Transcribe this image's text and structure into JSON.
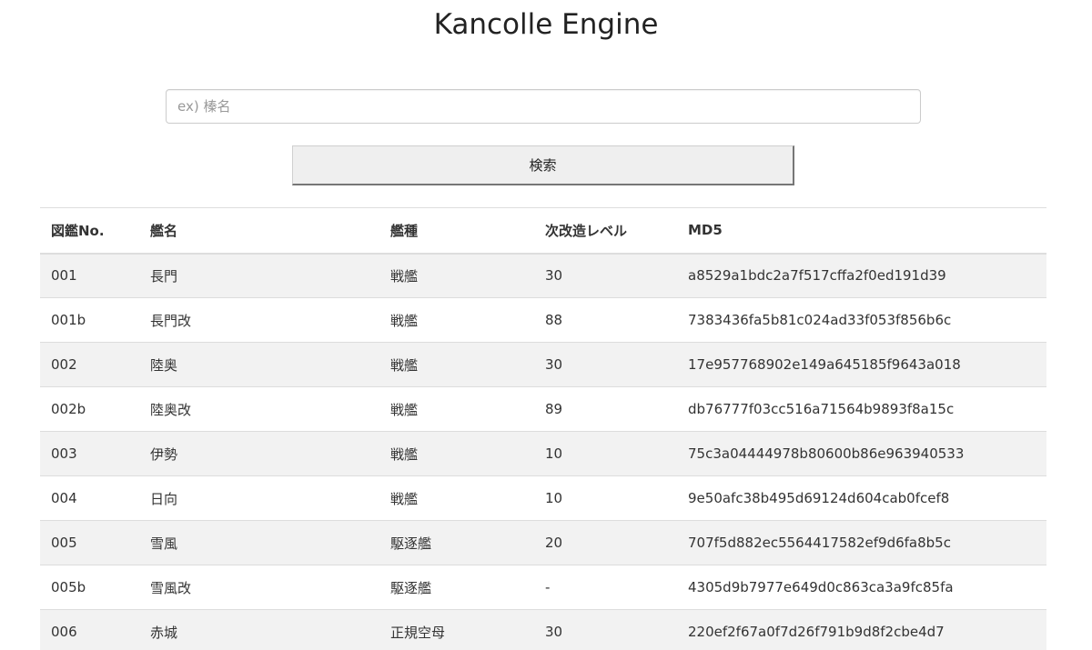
{
  "page": {
    "title": "Kancolle Engine"
  },
  "search": {
    "placeholder": "ex) 榛名",
    "value": "",
    "button_label": "検索"
  },
  "table": {
    "headers": [
      "図鑑No.",
      "艦名",
      "艦種",
      "次改造レベル",
      "MD5"
    ],
    "rows": [
      [
        "001",
        "長門",
        "戦艦",
        "30",
        "a8529a1bdc2a7f517cffa2f0ed191d39"
      ],
      [
        "001b",
        "長門改",
        "戦艦",
        "88",
        "7383436fa5b81c024ad33f053f856b6c"
      ],
      [
        "002",
        "陸奥",
        "戦艦",
        "30",
        "17e957768902e149a645185f9643a018"
      ],
      [
        "002b",
        "陸奥改",
        "戦艦",
        "89",
        "db76777f03cc516a71564b9893f8a15c"
      ],
      [
        "003",
        "伊勢",
        "戦艦",
        "10",
        "75c3a04444978b80600b86e963940533"
      ],
      [
        "004",
        "日向",
        "戦艦",
        "10",
        "9e50afc38b495d69124d604cab0fcef8"
      ],
      [
        "005",
        "雪風",
        "駆逐艦",
        "20",
        "707f5d882ec5564417582ef9d6fa8b5c"
      ],
      [
        "005b",
        "雪風改",
        "駆逐艦",
        "-",
        "4305d9b7977e649d0c863ca3a9fc85fa"
      ],
      [
        "006",
        "赤城",
        "正規空母",
        "30",
        "220ef2f67a0f7d26f791b9d8f2cbe4d7"
      ]
    ]
  }
}
